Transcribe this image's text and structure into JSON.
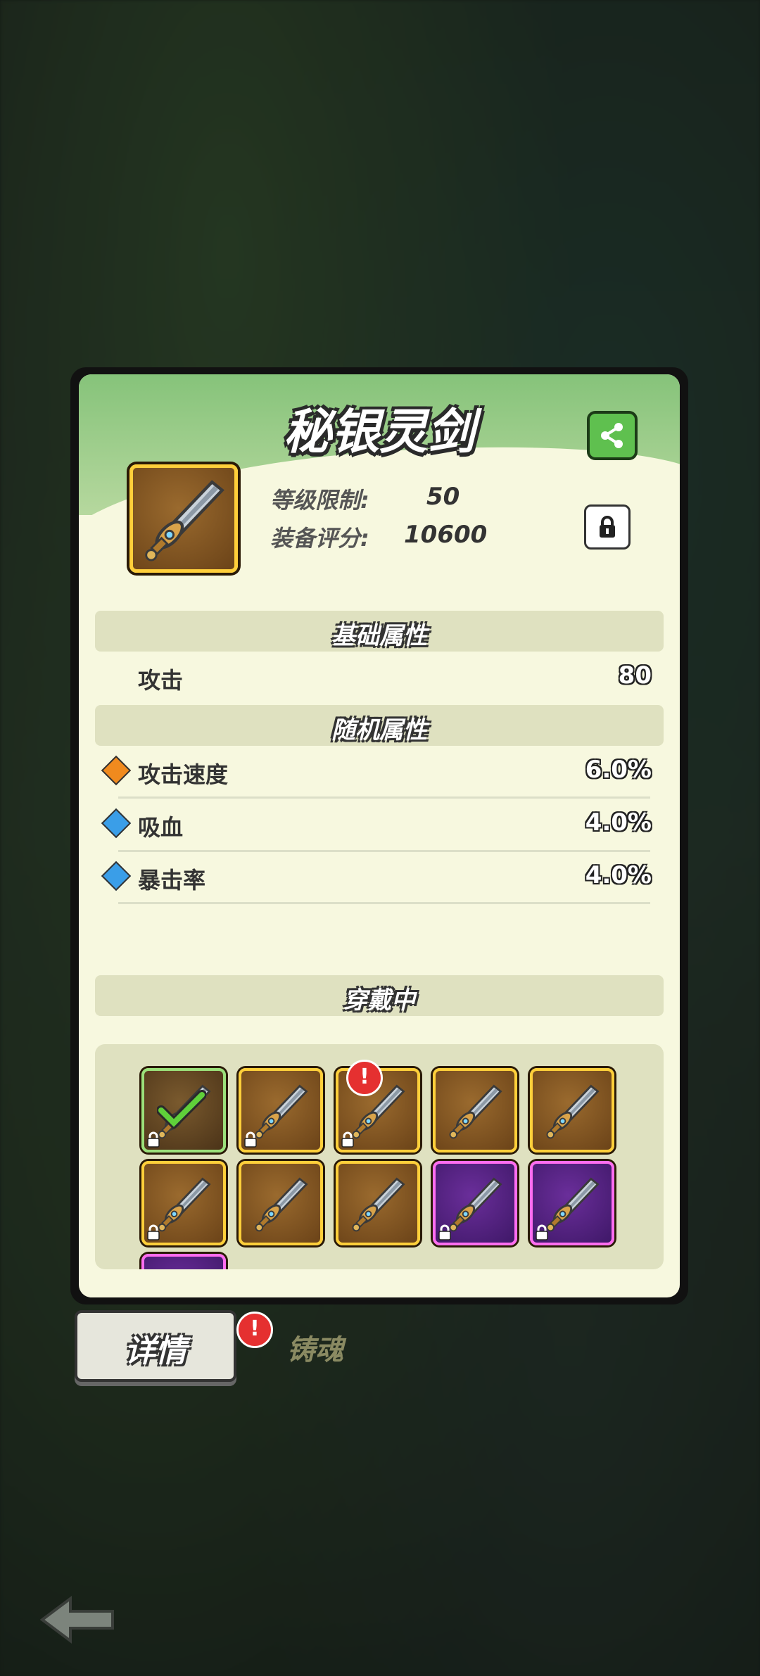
{
  "item": {
    "name": "秘银灵剑",
    "level_label": "等级限制:",
    "level_value": "50",
    "score_label": "装备评分:",
    "score_value": "10600"
  },
  "sections": {
    "base": "基础属性",
    "random": "随机属性",
    "equipped": "穿戴中"
  },
  "base_attrs": [
    {
      "name": "攻击",
      "value": "80"
    }
  ],
  "random_attrs": [
    {
      "name": "攻击速度",
      "value": "6.0%",
      "gem": "orange-gem-icon"
    },
    {
      "name": "吸血",
      "value": "4.0%",
      "gem": "blue-gem-icon"
    },
    {
      "name": "暴击率",
      "value": "4.0%",
      "gem": "blue-gem-icon"
    }
  ],
  "tabs": {
    "details": "详情",
    "forge": "铸魂"
  },
  "alert_symbol": "!",
  "colors": {
    "gold_frame": "#ffcf3a",
    "purple_frame": "#ff6df0",
    "header_green": "#86c37a",
    "card_bg": "#f7f8df"
  }
}
